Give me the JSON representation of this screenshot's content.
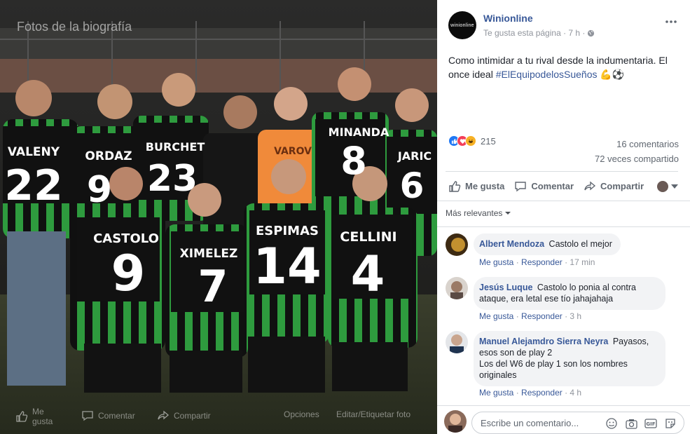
{
  "photo": {
    "album_title": "Fotos de la biografía",
    "players": [
      {
        "name": "VALENY",
        "number": "22"
      },
      {
        "name": "ORDAZ",
        "number": "9"
      },
      {
        "name": "BURCHET",
        "number": "23"
      },
      {
        "name": "VAROV",
        "number": ""
      },
      {
        "name": "MINANDA",
        "number": "8"
      },
      {
        "name": "JARIC",
        "number": "6"
      },
      {
        "name": "CASTOLO",
        "number": "9"
      },
      {
        "name": "XIMELEZ",
        "number": "7"
      },
      {
        "name": "ESPIMAS",
        "number": "14"
      },
      {
        "name": "CELLINI",
        "number": "4"
      }
    ],
    "actions": {
      "like": "Me gusta",
      "comment": "Comentar",
      "share": "Compartir",
      "options": "Opciones",
      "tag": "Editar/Etiquetar foto"
    }
  },
  "post": {
    "page_name": "Winionline",
    "avatar_text": "winionline",
    "meta": "Te gusta esta página · 7 h ·",
    "text": "Como intimidar a tu rival desde la indumentaria. El once ideal",
    "hashtag": "#ElEquipodelosSueños",
    "emoji": "💪⚽",
    "reactions_count": "215",
    "comments_count": "16 comentarios",
    "shares_count": "72 veces compartido",
    "actions": {
      "like": "Me gusta",
      "comment": "Comentar",
      "share": "Compartir"
    },
    "relevance_label": "Más relevantes"
  },
  "comments": [
    {
      "author": "Albert Mendoza",
      "text": "Castolo el mejor",
      "like": "Me gusta",
      "reply": "Responder",
      "time": "17 min"
    },
    {
      "author": "Jesús Luque",
      "text": "Castolo lo ponia al contra ataque, era letal ese tío jahajahaja",
      "like": "Me gusta",
      "reply": "Responder",
      "time": "3 h"
    },
    {
      "author": "Manuel Alejamdro Sierra Neyra",
      "text": "Payasos, esos son de play 2",
      "text2": "Los del W6 de play 1 son los nombres originales",
      "like": "Me gusta",
      "reply": "Responder",
      "time": "4 h"
    }
  ],
  "composer": {
    "placeholder": "Escribe un comentario..."
  },
  "colors": {
    "link": "#385898",
    "jersey_green": "#2e9b3e",
    "jersey_black": "#111111",
    "keeper_orange": "#f08a3a"
  }
}
